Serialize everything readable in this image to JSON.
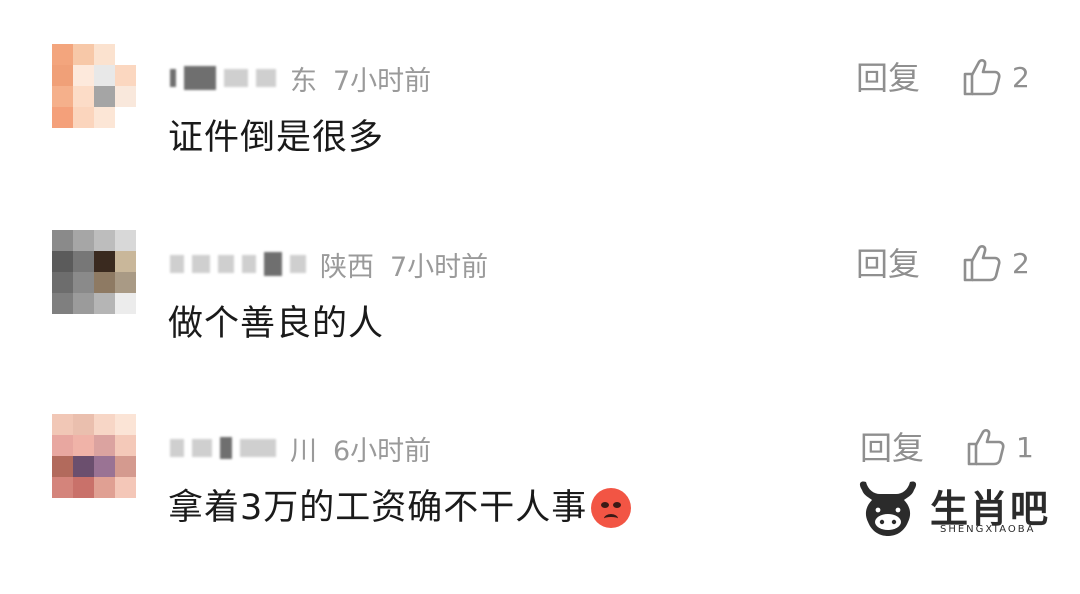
{
  "comments": [
    {
      "location": "东",
      "time": "7小时前",
      "reply_label": "回复",
      "likes": "2",
      "text": "证件倒是很多",
      "emoji": null
    },
    {
      "location": "陕西",
      "time": "7小时前",
      "reply_label": "回复",
      "likes": "2",
      "text": "做个善良的人",
      "emoji": null
    },
    {
      "location": "川",
      "time": "6小时前",
      "reply_label": "回复",
      "likes": "1",
      "text": "拿着3万的工资确不干人事",
      "emoji": "angry-face"
    }
  ],
  "watermark": {
    "title": "生肖吧",
    "subtitle": "SHENGXIAOBA"
  },
  "icons": {
    "like": "thumbs-up-icon",
    "emoji": "angry-face-icon",
    "logo": "ox-logo-icon"
  }
}
